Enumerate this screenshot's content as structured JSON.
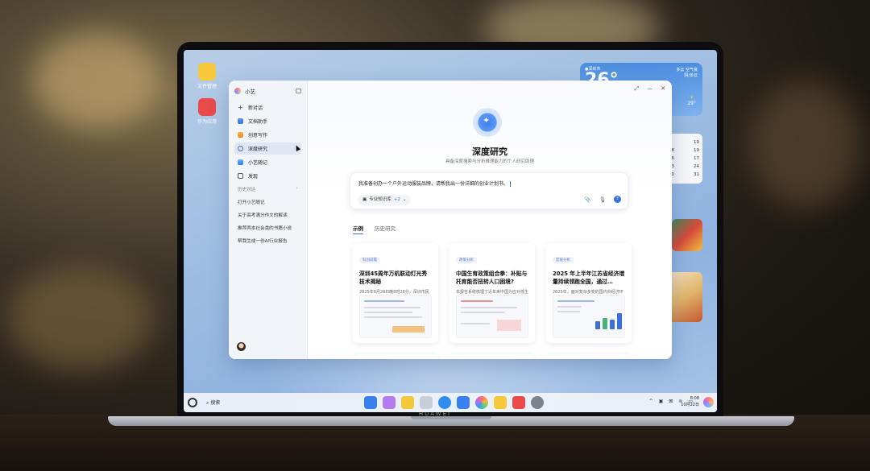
{
  "desktop": {
    "icons": [
      {
        "label": "文件管理",
        "color": "#f6c83a"
      },
      {
        "label": "华为应用",
        "color": "#e94b4b"
      }
    ],
    "weather": {
      "location": "●深圳市",
      "temp": "26°",
      "side1": "多云 空气良",
      "side2": "阴/多云",
      "fc_icon": "☀",
      "fc_temp": "29°"
    },
    "calendar": {
      "rows": [
        [
          "9",
          "10"
        ],
        [
          "18",
          "19"
        ],
        [
          "16",
          "17"
        ],
        [
          "23",
          "24"
        ],
        [
          "30",
          "31"
        ]
      ]
    }
  },
  "app": {
    "name": "小艺",
    "sidebar": {
      "items": [
        {
          "label": "新对话",
          "icon": "plus-icon"
        },
        {
          "label": "文档助手",
          "icon": "document-icon"
        },
        {
          "label": "创意写作",
          "icon": "pen-icon"
        },
        {
          "label": "深度研究",
          "icon": "research-icon",
          "active": true
        },
        {
          "label": "小艺随记",
          "icon": "note-icon"
        },
        {
          "label": "发现",
          "icon": "discover-icon"
        }
      ],
      "history_label": "历史对话",
      "history_chevron": "›",
      "history": [
        "打开小艺随记",
        "关于高考满分作文的解读",
        "推荐两本社会类的书籍小说",
        "帮我生成一份AI行业报告"
      ]
    },
    "window_controls": [
      "⤢",
      "—",
      "✕"
    ],
    "hero": {
      "title": "深度研究",
      "subtitle": "具备深度搜索与分析推理能力的个人研究助理"
    },
    "input": {
      "value": "我准备创办一个户外运动服装品牌，请帮我出一份详细的创业计划书。",
      "kb_chip": "专业知识库",
      "kb_count": "+2",
      "kb_chevron": "⌄",
      "tools": [
        "📎",
        "🎙",
        "↑"
      ]
    },
    "tabs": [
      {
        "label": "示例",
        "active": true
      },
      {
        "label": "历史研究",
        "active": false
      }
    ],
    "cards": [
      {
        "tag": "科创前瞻",
        "title": "深圳45周年万机联动灯光秀技术揭秘",
        "desc": "2025年8月26日晚8时26分，深圳市民广场与深圳人才公园的夜空被…"
      },
      {
        "tag": "政策分析",
        "title": "中国生育政策组合拳：补贴与托育能否扭转人口困境?",
        "desc": "本报告系统梳理了近年来中国为应对低生育率危机出台的核心生育支持…"
      },
      {
        "tag": "宏观分析",
        "title": "2025 年上半年江苏省经济增量持续领跑全国，通过…",
        "desc": "2025年，面对复杂多变的国内外经济环境，江苏省以其稳健而强劲的发…"
      }
    ]
  },
  "taskbar": {
    "search_label": "搜索",
    "apps": [
      {
        "icon": "start-grid-icon",
        "color": "#3b7ff0"
      },
      {
        "icon": "gallery-icon",
        "color": "#b57cf0"
      },
      {
        "icon": "notes-icon",
        "color": "#f5c73a"
      },
      {
        "icon": "trash-icon",
        "color": "#c9ced6"
      },
      {
        "icon": "browser-icon",
        "color": "#2f8cf0"
      },
      {
        "icon": "mail-icon",
        "color": "#3a80f0"
      },
      {
        "icon": "photos-icon",
        "color": "#ffa63a"
      },
      {
        "icon": "files-icon",
        "color": "#f6c83a"
      },
      {
        "icon": "appstore-icon",
        "color": "#e94b4b"
      },
      {
        "icon": "settings-icon",
        "color": "#7d838c"
      }
    ],
    "tray": [
      "^",
      "▣",
      "⊠",
      "≋",
      "▭"
    ],
    "time": "8:08",
    "date": "10月22日"
  },
  "brand": "HUAWEI"
}
